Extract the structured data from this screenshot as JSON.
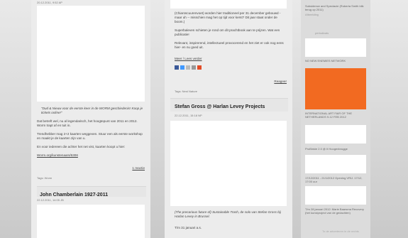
{
  "left_col": {
    "top_meta": "20.12.2011, 9:52 AP",
    "quote": "\"Dud & Nieuw voor de eerste keer in de WORM geschiedenis! Koop je tickets online!\"",
    "para1": "Dat betreft wel, nu al legendarisch, het hoogtepunt van 2011 en 2012. Worm trapt af en tuit in.",
    "para2": "Trendhebber mag 2+2 kaarten weggeven. Stuur een als eerste workshop en maakt je de kaarten zijn van u.",
    "para3": "En voor iedereen die achter het net vist, kaarten koopt u hier:",
    "link": "Worm.org/kunstenaars/6306",
    "more": "1 reactie",
    "tags": "Tags: Worm",
    "post_title": "John Chamberlain 1927-2011",
    "post_meta": "22.12.2011, 14:05 JB"
  },
  "mid_col": {
    "para_a": "(Chiaroscuurenvoet) worden hier traditioneel per 31 december gebouwd - maar uh -- misschien mag het op tijd voor kerst? Dit jaar staat onder de boom.)",
    "para_b": "Superbaleven schieten je rond om dit prachtbook aan te prijzen. Wat een publicatie!",
    "para_c": "Relevant, inspirerend, intellectueel provocerend en het ziet er ook nog eens hier- en nu goed uit.",
    "read_more": "Meer / Lees verder",
    "respond": "Reageer",
    "tags": "Tags: Nest Nature",
    "post_title": "Stefan Gross @ Harlan Levey Projects",
    "post_meta": "22.12.2011, 15:18 NP",
    "bottom_p1": "(The precarious future of) Sustainable Trash, de solo van Stefan Gross bij Harlan Levey in Brussel.",
    "bottom_p2": "T/m 31 januari a.s."
  },
  "right_col": {
    "top_line": "Subsidence and Spectacle (Roberta Smith blik terug op 2011)",
    "top_sub": "Afbeelding",
    "section_label": "periodicals",
    "l1": "NO NEW ENEMIES NETWORK",
    "l2": "INTERNATIONAL ART FAIR OF THE NETHERLANDS 9-12 FEB 2012",
    "l3": "ProBinkie 2.0 @ It Hoogenbrugge",
    "l4": "17/12/2011 - 21/1/2012 Opening VRIJ. 17/12, 17:00 uur",
    "l5": "T/m 28 januari 2012: Marie Baarsma Recovery (het kunstproject van de gedachten)",
    "bottom_label": "To de adverteren in de rechts"
  },
  "colors": {
    "accent_orange": "#f26a21",
    "link_blue": "#2a64b8"
  }
}
